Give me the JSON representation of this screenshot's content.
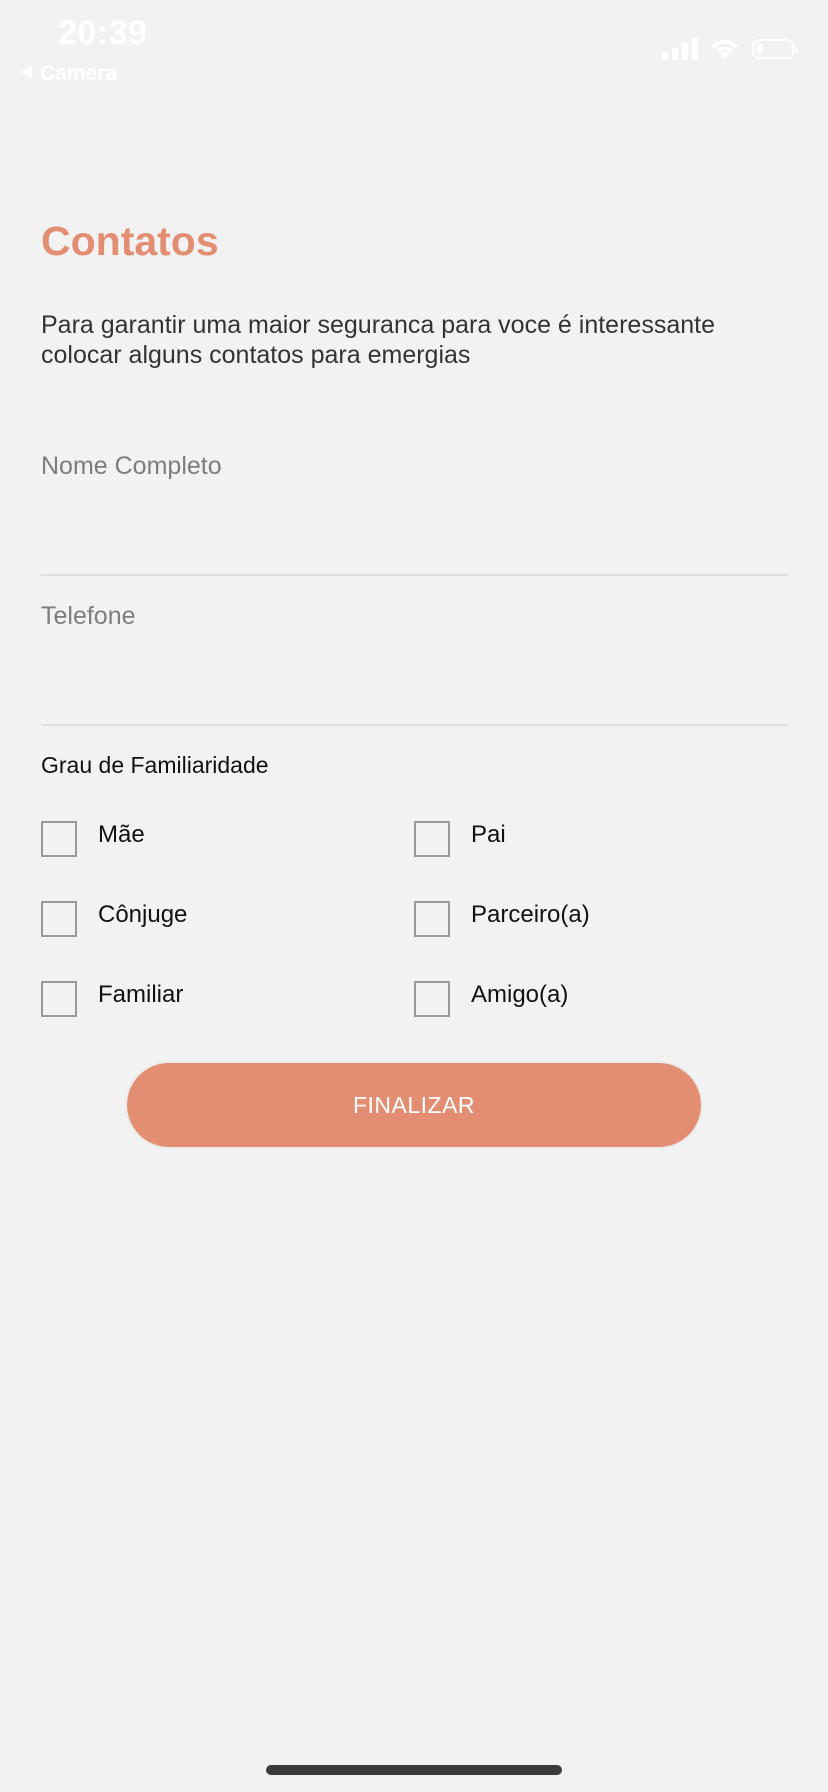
{
  "status_bar": {
    "time": "20:39",
    "back_app": "Camera"
  },
  "page": {
    "title": "Contatos",
    "intro": "Para garantir uma maior seguranca para voce é interessante colocar alguns contatos para emergias"
  },
  "form": {
    "fields": [
      {
        "label": "Nome Completo",
        "value": ""
      },
      {
        "label": "Telefone",
        "value": ""
      }
    ],
    "relationship": {
      "label": "Grau de Familiaridade",
      "options": [
        "Mãe",
        "Pai",
        "Cônjuge",
        "Parceiro(a)",
        "Familiar",
        "Amigo(a)"
      ]
    },
    "submit_label": "FINALIZAR"
  },
  "colors": {
    "accent": "#e38e73",
    "background": "#f2f2f2"
  }
}
